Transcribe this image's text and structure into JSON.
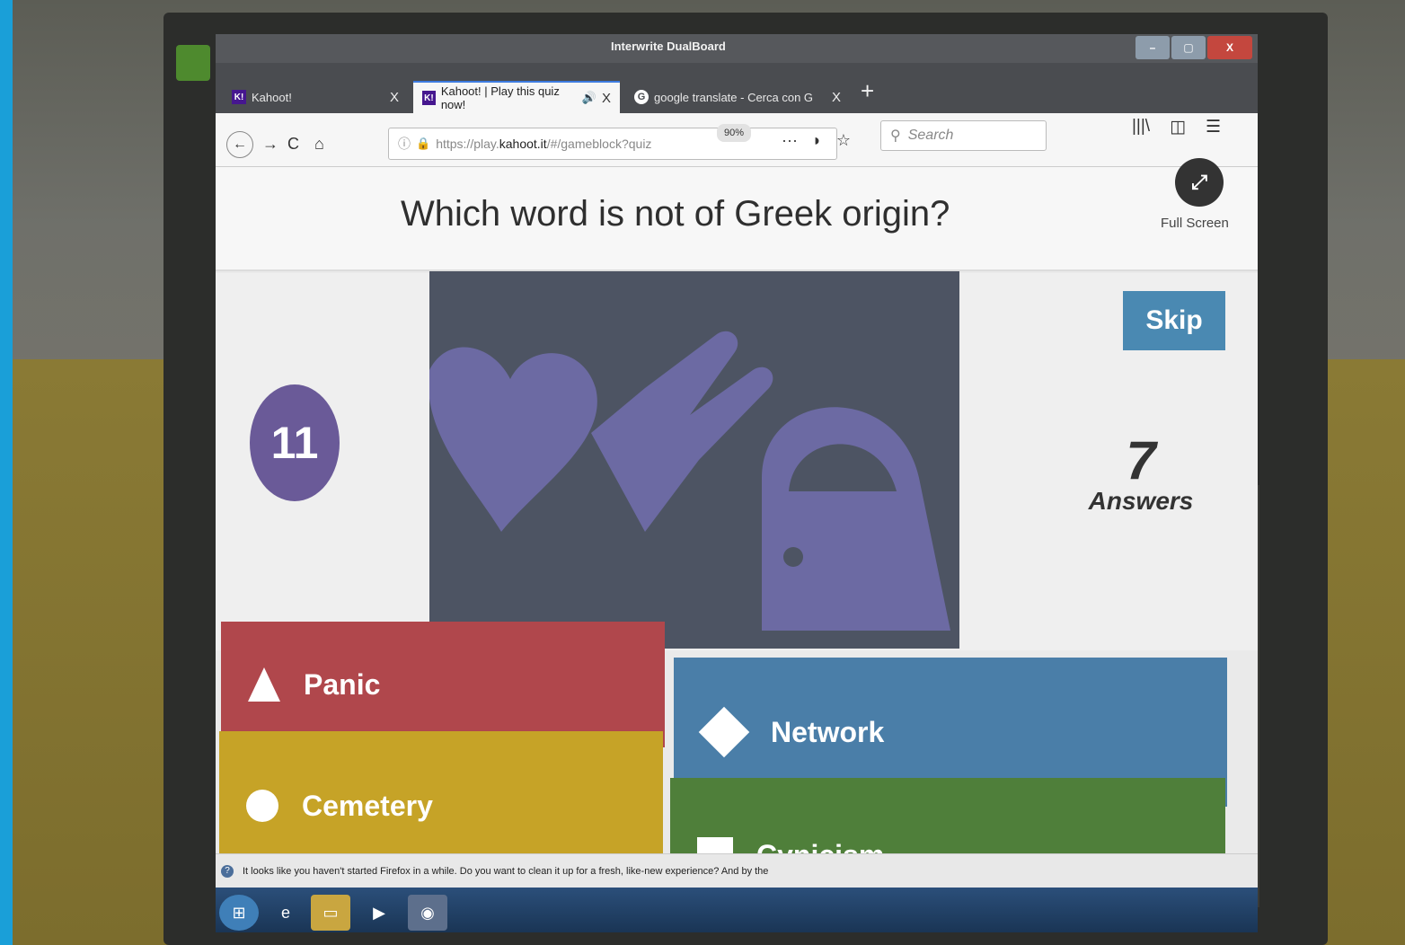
{
  "window": {
    "title": "Interwrite DualBoard",
    "minimize": "–",
    "maximize": "▢",
    "close": "X"
  },
  "tabs": [
    {
      "label": "Kahoot!",
      "close": "X"
    },
    {
      "label": "Kahoot! | Play this quiz now!",
      "close": "X"
    },
    {
      "label": "google translate - Cerca con G",
      "close": "X"
    }
  ],
  "new_tab": "+",
  "nav": {
    "back": "←",
    "forward": "→",
    "reload": "C",
    "home": "⌂"
  },
  "address": {
    "prefix": "https://play.",
    "host": "kahoot.it",
    "path": "/#/gameblock?quiz",
    "zoom": "90%"
  },
  "toolbar": {
    "more": "···",
    "pocket": "◗",
    "bookmark": "☆",
    "search_placeholder": "Search",
    "library": "|||\\",
    "sidebar": "◫",
    "menu": "☰"
  },
  "quiz": {
    "question": "Which word is not of Greek origin?",
    "fullscreen_label": "Full Screen",
    "fullscreen_icon": "⤢",
    "timer": "11",
    "skip_label": "Skip",
    "answers_count": "7",
    "answers_label": "Answers",
    "options": [
      {
        "label": "Panic",
        "shape": "triangle",
        "color": "#b0474c"
      },
      {
        "label": "Network",
        "shape": "diamond",
        "color": "#4a7ea8"
      },
      {
        "label": "Cemetery",
        "shape": "circle",
        "color": "#c6a327"
      },
      {
        "label": "Cynicism",
        "shape": "square",
        "color": "#4f7f3a"
      }
    ]
  },
  "notice": {
    "text": "It looks like you haven't started Firefox in a while. Do you want to clean it up for a fresh, like-new experience? And by the"
  },
  "colors": {
    "kahoot_purple": "#6a5a98",
    "skip_blue": "#4a89b2",
    "image_bg": "#4d5463"
  }
}
